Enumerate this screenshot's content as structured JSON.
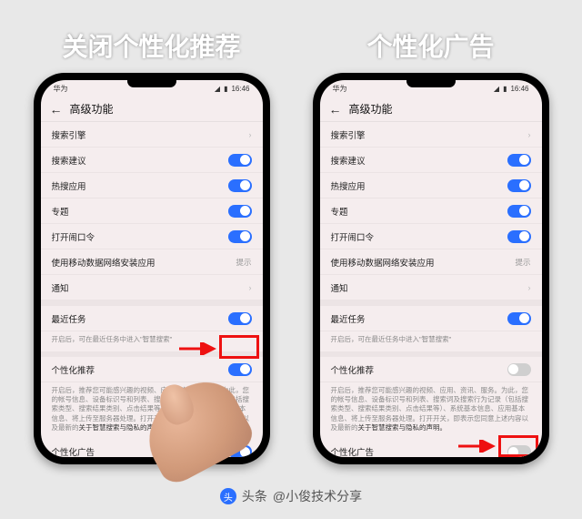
{
  "captions": {
    "left": "关闭个性化推荐",
    "right": "个性化广告"
  },
  "statusbar": {
    "left": "华为",
    "time": "16:46"
  },
  "nav": {
    "title": "高级功能"
  },
  "rows": {
    "searchEngine": "搜索引擎",
    "searchSuggest": "搜索建议",
    "hotApps": "热搜应用",
    "topics": "专题",
    "openCmd": "打开闹口令",
    "mobileData": "使用移动数据网络安装应用",
    "notify": "通知",
    "recentTask": "最近任务",
    "personalRec": "个性化推荐",
    "personalAd": "个性化广告",
    "hintText": "提示"
  },
  "descs": {
    "recentTask": "开启后，可在最近任务中进入\"智慧搜索\"",
    "personalRec1": "开启后，推荐您可能感兴趣的视频、应用、资讯、服务。为此，您的帐号信息、设备标识号和列表、搜索词及搜索行为记录（包括搜索类型、搜索结果类别、点击结果等）、系统基本信息、应用基本信息、将上传至服务器处理。打开开关，即表示您同意上述内容以及最新的",
    "personalRecBold": "关于智慧搜索与隐私的声明。"
  },
  "footer": {
    "prefix": "头条",
    "author": "@小俊技术分享"
  }
}
